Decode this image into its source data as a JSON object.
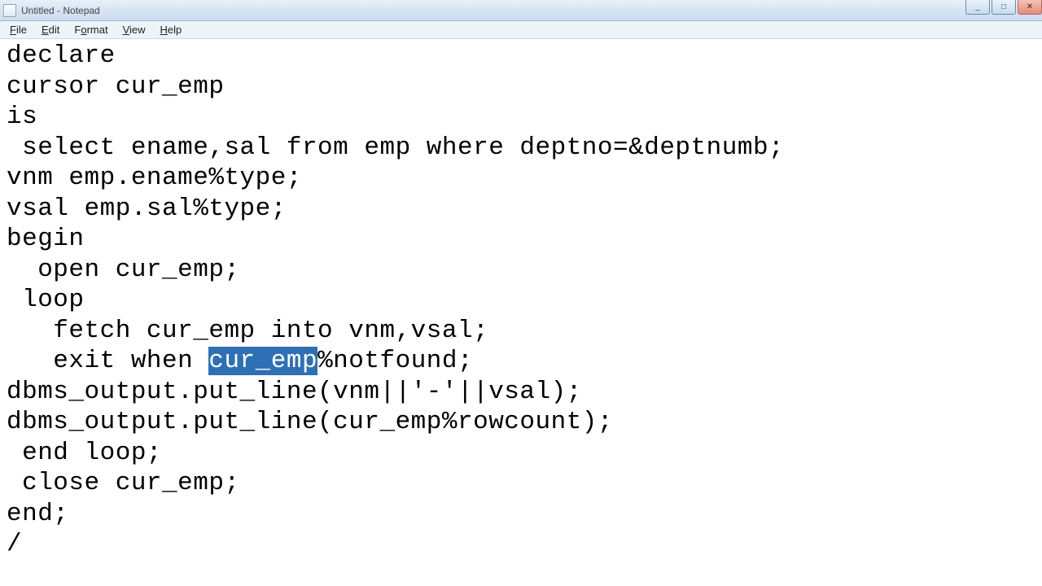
{
  "titlebar": {
    "text": "Untitled - Notepad"
  },
  "menu": {
    "file": "File",
    "edit": "Edit",
    "format": "Format",
    "view": "View",
    "help": "Help"
  },
  "code": {
    "l1": "declare",
    "l2": "cursor cur_emp",
    "l3": "is",
    "l4": " select ename,sal from emp where deptno=&deptnumb;",
    "l5": "vnm emp.ename%type;",
    "l6": "vsal emp.sal%type;",
    "l7": "begin",
    "l8": "  open cur_emp;",
    "l9": " loop",
    "l10": "   fetch cur_emp into vnm,vsal;",
    "l11a": "   exit when ",
    "l11sel": "cur_emp",
    "l11b": "%notfound;",
    "l12": "dbms_output.put_line(vnm||'-'||vsal);",
    "l13": "dbms_output.put_line(cur_emp%rowcount);",
    "l14": " end loop;",
    "l15": " close cur_emp;",
    "l16": "end;",
    "l17": "/"
  },
  "win_controls": {
    "min": "_",
    "max": "□",
    "close": "✕"
  }
}
